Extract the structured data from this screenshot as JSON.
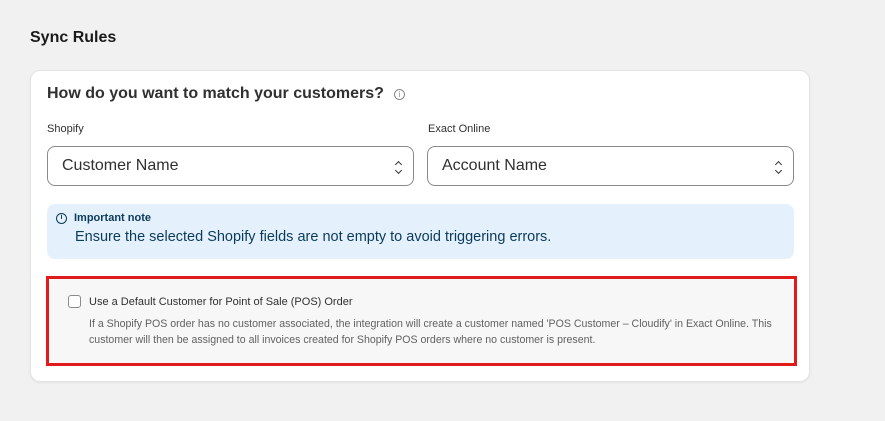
{
  "section_title": "Sync Rules",
  "card": {
    "heading": "How do you want to match your customers?",
    "info_icon": "info-icon",
    "shopify": {
      "label": "Shopify",
      "value": "Customer Name"
    },
    "exact": {
      "label": "Exact Online",
      "value": "Account Name"
    },
    "note": {
      "title": "Important note",
      "text": "Ensure the selected Shopify fields are not empty to avoid triggering errors."
    },
    "pos": {
      "checked": false,
      "label": "Use a Default Customer for Point of Sale (POS) Order",
      "help": "If a Shopify POS order has no customer associated, the integration will create a customer named 'POS Customer – Cloudify' in Exact Online. This customer will then be assigned to all invoices created for Shopify POS orders where no customer is present."
    }
  },
  "colors": {
    "page_bg": "#f1f1f1",
    "note_bg": "#e4f1fc",
    "note_text": "#0a3a5c",
    "highlight": "#e11b1b"
  }
}
